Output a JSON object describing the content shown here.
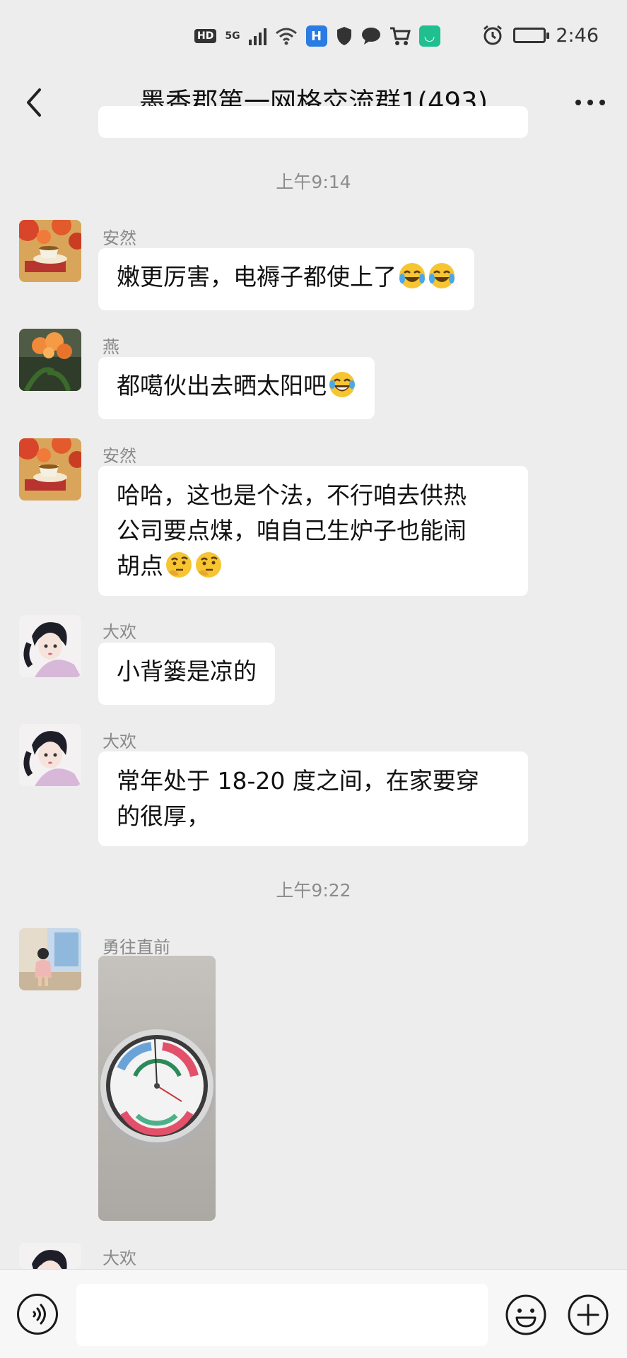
{
  "status_bar": {
    "hd": "HD",
    "network": "5G",
    "time": "2:46"
  },
  "nav": {
    "title": "墨香郡第一网格交流群1(493)"
  },
  "chat": {
    "timestamps": [
      "上午9:14",
      "上午9:22"
    ],
    "messages": [
      {
        "sender": "安然",
        "text": "嫩更厉害，电褥子都使上了",
        "emojis": [
          "laughing-crying-emoji",
          "laughing-crying-emoji"
        ]
      },
      {
        "sender": "燕",
        "text": "都噶伙出去晒太阳吧",
        "emojis": [
          "tears-of-joy-emoji"
        ]
      },
      {
        "sender": "安然",
        "line1": "哈哈，这也是个法，不行咱去供热",
        "line2": "公司要点煤，咱自己生炉子也能闹",
        "line3": "胡点",
        "emojis": [
          "thinking-emoji",
          "thinking-emoji"
        ]
      },
      {
        "sender": "大欢",
        "text": "小背篓是凉的"
      },
      {
        "sender": "大欢",
        "line1": "常年处于 18-20 度之间，在家要穿",
        "line2": "的很厚，"
      },
      {
        "sender": "勇往直前",
        "image": "thermometer-hygrometer-photo"
      },
      {
        "sender": "大欢"
      }
    ]
  },
  "input_bar": {
    "voice_icon": "voice-icon",
    "emoji_icon": "emoji-icon",
    "more_icon": "plus-icon"
  },
  "colors": {
    "background": "#ededed",
    "bubble": "#ffffff",
    "timestamp": "#8c8c8c"
  }
}
